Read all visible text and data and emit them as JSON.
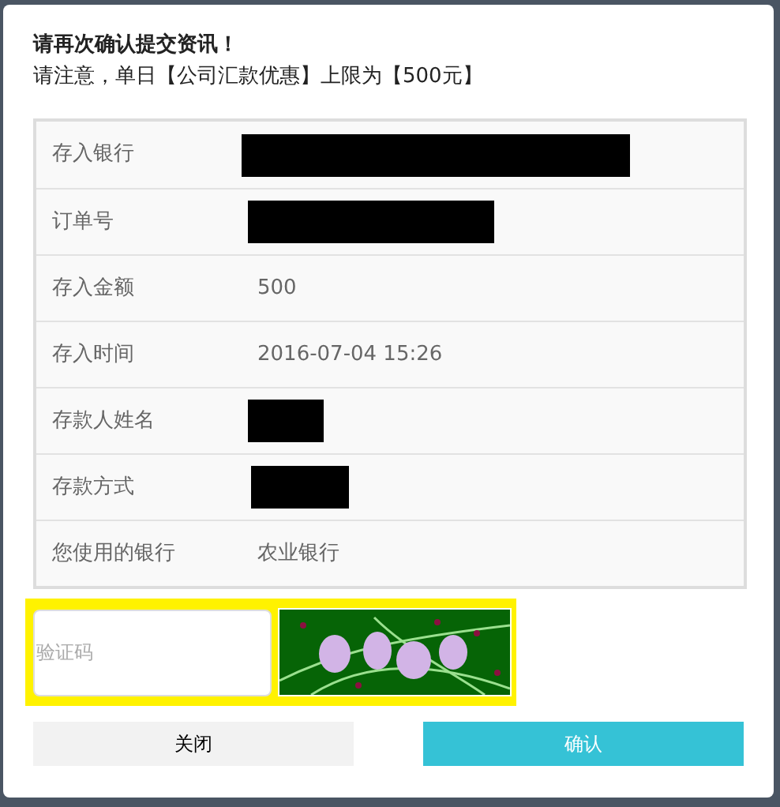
{
  "dialog": {
    "title": "请再次确认提交资讯！",
    "notice": "请注意，单日【公司汇款优惠】上限为【500元】"
  },
  "rows": [
    {
      "label": "存入银行",
      "kind": "redacted"
    },
    {
      "label": "订单号",
      "kind": "redacted"
    },
    {
      "label": "存入金额",
      "kind": "text",
      "value": "500"
    },
    {
      "label": "存入时间",
      "kind": "text",
      "value": "2016-07-04 15:26"
    },
    {
      "label": "存款人姓名",
      "kind": "redacted"
    },
    {
      "label": "存款方式",
      "kind": "redacted"
    },
    {
      "label": "您使用的银行",
      "kind": "text",
      "value": "农业银行"
    }
  ],
  "captcha": {
    "placeholder": "验证码",
    "highlighted": true
  },
  "buttons": [
    {
      "label": "关闭",
      "kind": "secondary"
    },
    {
      "label": "确认",
      "kind": "primary"
    }
  ]
}
